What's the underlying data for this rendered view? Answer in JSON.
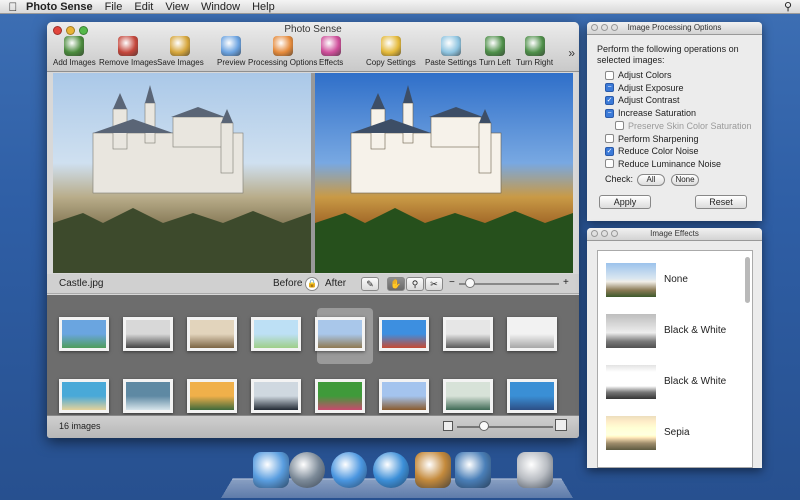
{
  "menubar": {
    "app_name": "Photo Sense",
    "items": [
      "File",
      "Edit",
      "View",
      "Window",
      "Help"
    ]
  },
  "window": {
    "title": "Photo Sense",
    "toolbar": [
      {
        "label": "Add Images",
        "icon": "add-images-icon",
        "color": "#4a8a3c"
      },
      {
        "label": "Remove Images",
        "icon": "remove-images-icon",
        "color": "#c4463b"
      },
      {
        "label": "Save Images",
        "icon": "save-images-icon",
        "color": "#d6a63b"
      },
      {
        "label": "Preview",
        "icon": "preview-icon",
        "color": "#6aa2e0"
      },
      {
        "label": "Processing Options",
        "icon": "processing-options-icon",
        "color": "#e58a3b"
      },
      {
        "label": "Effects",
        "icon": "effects-icon",
        "color": "#cf4e9a"
      },
      {
        "label": "Copy Settings",
        "icon": "copy-settings-icon",
        "color": "#e4b93a"
      },
      {
        "label": "Paste Settings",
        "icon": "paste-settings-icon",
        "color": "#8ec4e0"
      },
      {
        "label": "Turn Left",
        "icon": "turn-left-icon",
        "color": "#4e8f49"
      },
      {
        "label": "Turn Right",
        "icon": "turn-right-icon",
        "color": "#4e8f49"
      }
    ],
    "preview": {
      "file_name": "Castle.jpg",
      "before_label": "Before",
      "after_label": "After"
    },
    "status": {
      "image_count": "16 images"
    }
  },
  "thumbnails": [
    {
      "colors": [
        "#6aa5e0",
        "#4f9d5b"
      ]
    },
    {
      "colors": [
        "#d8d8d8",
        "#444444"
      ]
    },
    {
      "colors": [
        "#e2d4bc",
        "#7c6544"
      ]
    },
    {
      "colors": [
        "#bde0f5",
        "#9fcf88"
      ]
    },
    {
      "colors": [
        "#a9c7ea",
        "#8f7a52"
      ]
    },
    {
      "colors": [
        "#3d8fe0",
        "#c64a33"
      ]
    },
    {
      "colors": [
        "#e6e6e6",
        "#5a5a5a"
      ]
    },
    {
      "colors": [
        "#f2f2f2",
        "#a7a7a7"
      ]
    },
    {
      "colors": [
        "#49a9d8",
        "#e5d39a"
      ]
    },
    {
      "colors": [
        "#5e89a3",
        "#d6e4ea"
      ]
    },
    {
      "colors": [
        "#f0b04a",
        "#3e6a3b"
      ]
    },
    {
      "colors": [
        "#cfd8e0",
        "#222a34"
      ]
    },
    {
      "colors": [
        "#3f9a3a",
        "#c94a6e"
      ]
    },
    {
      "colors": [
        "#a4c4ee",
        "#8a5b2e"
      ]
    },
    {
      "colors": [
        "#d7e2d8",
        "#3f6a55"
      ]
    },
    {
      "colors": [
        "#3a8fd5",
        "#2d4f86"
      ]
    }
  ],
  "processing_panel": {
    "title": "Image Processing Options",
    "description": "Perform the following operations on selected images:",
    "options": [
      {
        "label": "Adjust Colors",
        "checked": false,
        "disabled": false,
        "indent": false
      },
      {
        "label": "Adjust Exposure",
        "checked": "mixed",
        "disabled": false,
        "indent": false
      },
      {
        "label": "Adjust Contrast",
        "checked": true,
        "disabled": false,
        "indent": false
      },
      {
        "label": "Increase Saturation",
        "checked": "mixed",
        "disabled": false,
        "indent": false
      },
      {
        "label": "Preserve Skin Color Saturation",
        "checked": false,
        "disabled": true,
        "indent": true
      },
      {
        "label": "Perform Sharpening",
        "checked": false,
        "disabled": false,
        "indent": false
      },
      {
        "label": "Reduce Color Noise",
        "checked": true,
        "disabled": false,
        "indent": false
      },
      {
        "label": "Reduce Luminance Noise",
        "checked": false,
        "disabled": false,
        "indent": false
      }
    ],
    "check_label": "Check:",
    "all_label": "All",
    "none_label": "None",
    "apply_label": "Apply",
    "reset_label": "Reset"
  },
  "effects_panel": {
    "title": "Image Effects",
    "effects": [
      {
        "name": "None",
        "filter": "none"
      },
      {
        "name": "Black & White",
        "filter": "grayscale(1)"
      },
      {
        "name": "Black & White",
        "filter": "grayscale(1) contrast(1.6)"
      },
      {
        "name": "Sepia",
        "filter": "sepia(0.8)"
      }
    ]
  },
  "dock": {
    "icons": [
      {
        "name": "finder-icon",
        "color": "#5a9ee0"
      },
      {
        "name": "launchpad-icon",
        "color": "#7c8a98"
      },
      {
        "name": "safari-icon",
        "color": "#4a96e0"
      },
      {
        "name": "itunes-icon",
        "color": "#3c8fd8"
      },
      {
        "name": "iphoto-icon",
        "color": "#c48a3c"
      },
      {
        "name": "photo-sense-icon",
        "color": "#4a7fb8"
      },
      {
        "name": "trash-icon",
        "color": "#b8bcc2"
      }
    ]
  }
}
